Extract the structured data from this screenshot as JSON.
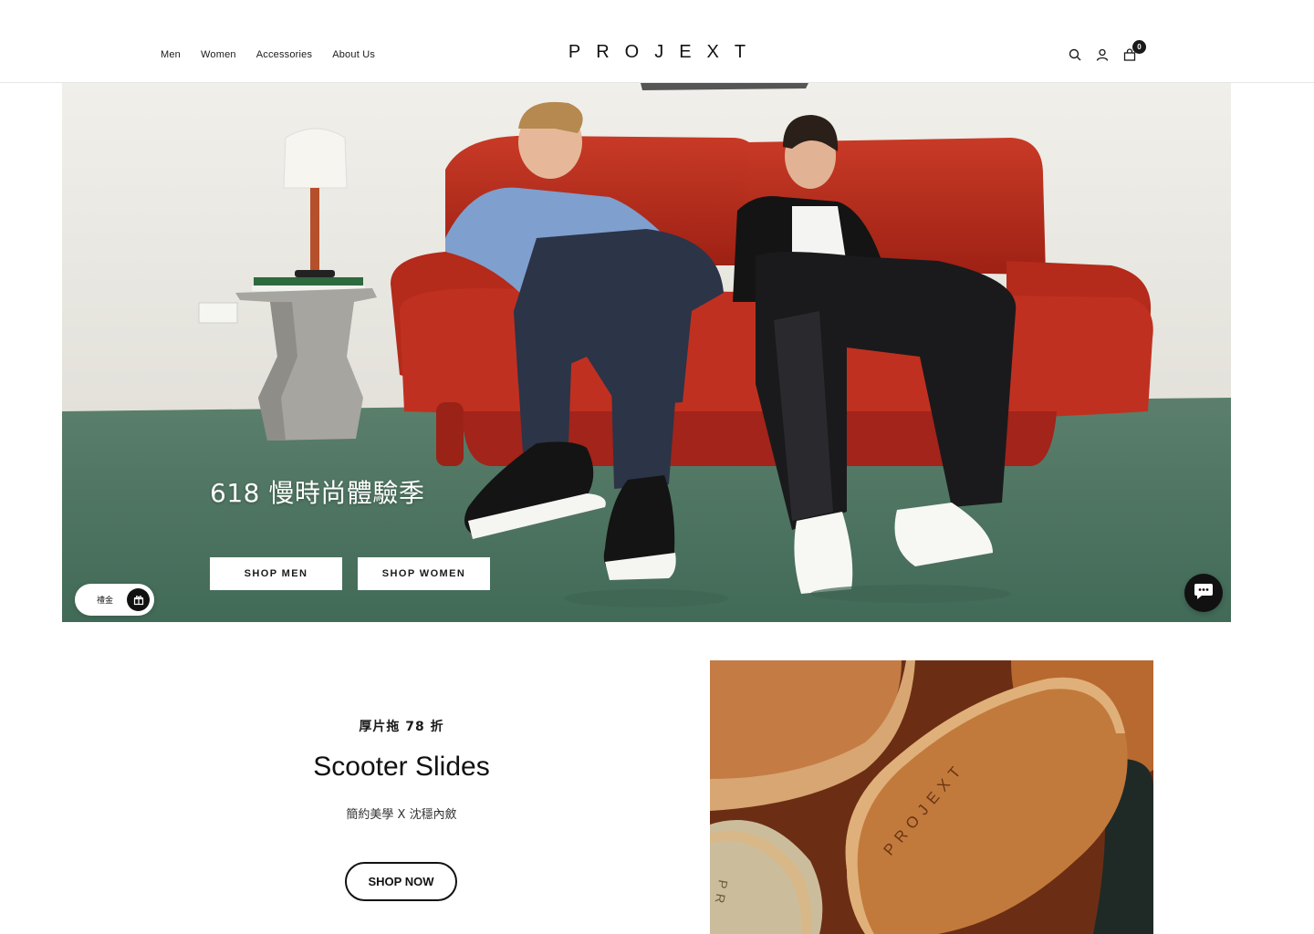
{
  "header": {
    "nav": [
      "Men",
      "Women",
      "Accessories",
      "About Us"
    ],
    "logo": "PROJEXT",
    "cart_count": "0",
    "icons": [
      "search-icon",
      "account-icon",
      "cart-icon"
    ]
  },
  "hero": {
    "title": "618 慢時尚體驗季",
    "shop_men_label": "SHOP MEN",
    "shop_women_label": "SHOP WOMEN",
    "reward_label": "禮金"
  },
  "promo": {
    "kicker": "厚片拖 78 折",
    "title": "Scooter Slides",
    "subtitle": "簡約美學 X 沈穩內斂",
    "button_label": "SHOP NOW",
    "image_text_large": "PROJEXT",
    "image_text_small": "PR"
  },
  "colors": {
    "sofa": "#b8291c",
    "floor": "#4f7a66",
    "wall": "#ecebe6",
    "leather": "#b0642d",
    "dark": "#111111"
  }
}
